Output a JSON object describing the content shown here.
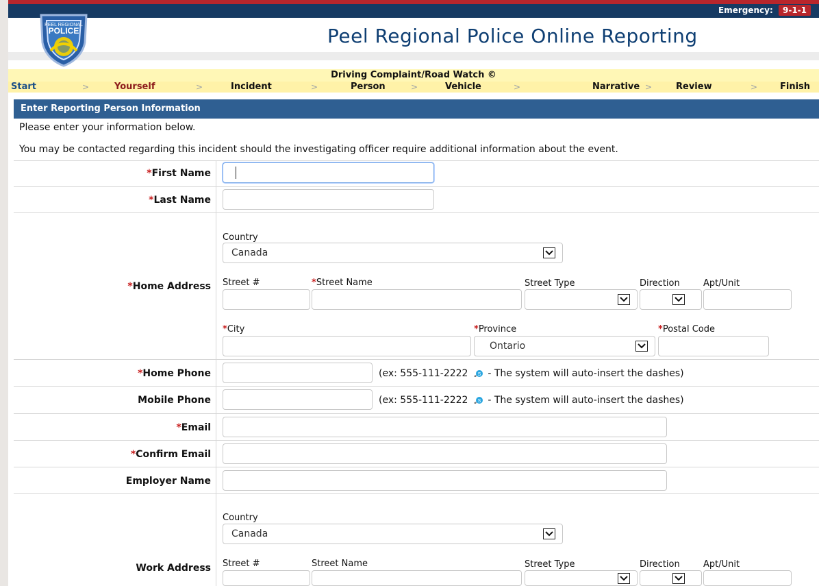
{
  "header": {
    "emergency_label": "Emergency:",
    "emergency_number": "9-1-1",
    "logo": {
      "line1": "PEEL REGIONAL",
      "line2": "POLICE"
    },
    "site_title": "Peel Regional Police Online Reporting"
  },
  "form": {
    "title": "Driving Complaint/Road Watch ©",
    "steps": [
      "Start",
      "Yourself",
      "Incident",
      "Person",
      "Vehicle",
      "Narrative",
      "Review",
      "Finish"
    ],
    "active_step": "Yourself"
  },
  "section": {
    "title": "Enter Reporting Person Information",
    "note1": "Please enter your information below.",
    "note2": "You may be contacted regarding this incident should the investigating officer require additional information about the event."
  },
  "fields": {
    "first_name": {
      "label": "First Name",
      "value": ""
    },
    "last_name": {
      "label": "Last Name",
      "value": ""
    },
    "home_address": {
      "label": "Home Address",
      "country_label": "Country",
      "country_value": "Canada",
      "street_no_label": "Street #",
      "street_name_label": "Street Name",
      "street_type_label": "Street Type",
      "direction_label": "Direction",
      "apt_label": "Apt/Unit",
      "city_label": "City",
      "province_label": "Province",
      "province_value": "Ontario",
      "postal_label": "Postal Code"
    },
    "home_phone": {
      "label": "Home Phone",
      "hint_prefix": "(ex: 555-111-2222",
      "hint_suffix": " - The system will auto-insert the dashes)"
    },
    "mobile_phone": {
      "label": "Mobile Phone",
      "hint_prefix": "(ex: 555-111-2222",
      "hint_suffix": " - The system will auto-insert the dashes)"
    },
    "email": {
      "label": "Email"
    },
    "confirm_email": {
      "label": "Confirm Email"
    },
    "employer_name": {
      "label": "Employer Name"
    },
    "work_address": {
      "label": "Work Address",
      "country_label": "Country",
      "country_value": "Canada",
      "street_no_label": "Street #",
      "street_name_label": "Street Name",
      "street_type_label": "Street Type",
      "direction_label": "Direction",
      "apt_label": "Apt/Unit"
    }
  },
  "colors": {
    "navy": "#163a63",
    "red": "#b8262c",
    "section_blue": "#2f5f92",
    "yellow": "#fff2a8",
    "link_blue": "#1b4f87"
  },
  "icons": {
    "dropdown": "chevron-down-icon",
    "phone": "skype-phone-icon",
    "logo": "police-badge-logo"
  }
}
